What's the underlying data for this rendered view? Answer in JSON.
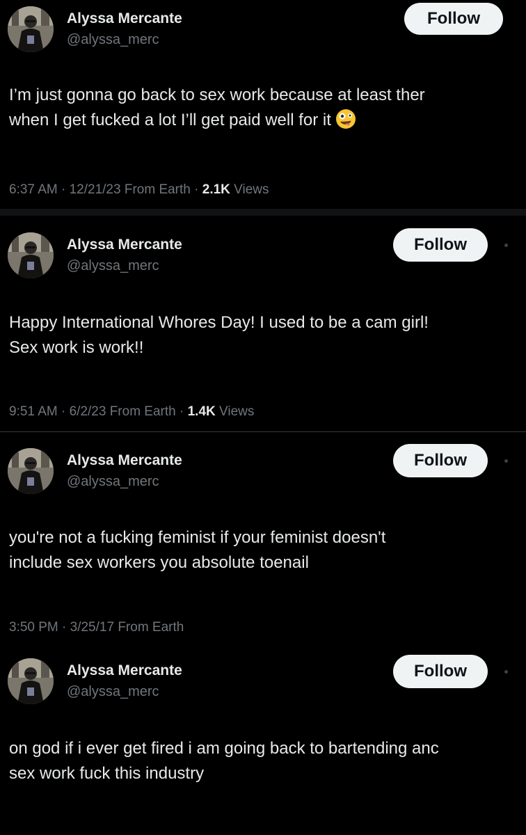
{
  "tweets": [
    {
      "name": "Alyssa Mercante",
      "handle": "@alyssa_merc",
      "follow_label": "Follow",
      "lines": [
        "I’m just gonna go back to sex work because at least ther",
        "when I get fucked a lot I’ll get paid well for it"
      ],
      "emoji": "zany-face-emoji",
      "meta": "6:37 AM · 12/21/23 From Earth · ",
      "views_count": "2.1K",
      "views_label": "Views"
    },
    {
      "name": "Alyssa Mercante",
      "handle": "@alyssa_merc",
      "follow_label": "Follow",
      "lines": [
        "Happy International Whores Day! I used to be a cam girl!",
        "Sex work is work!!"
      ],
      "meta": "9:51 AM · 6/2/23 From Earth · ",
      "views_count": "1.4K",
      "views_label": "Views"
    },
    {
      "name": "Alyssa Mercante",
      "handle": "@alyssa_merc",
      "follow_label": "Follow",
      "lines": [
        "you're not a fucking feminist if your feminist doesn't",
        "include sex workers you absolute toenail"
      ],
      "meta": "3:50 PM · 3/25/17 From Earth"
    },
    {
      "name": "Alyssa Mercante",
      "handle": "@alyssa_merc",
      "follow_label": "Follow",
      "lines": [
        "on god if i ever get fired i am going back to bartending anc",
        "sex work fuck this industry"
      ]
    }
  ],
  "colors": {
    "background": "#000000",
    "text": "#e7e9ea",
    "muted": "#71767b",
    "button_bg": "#eff3f4",
    "button_text": "#0f1419",
    "divider": "#2f3336"
  }
}
